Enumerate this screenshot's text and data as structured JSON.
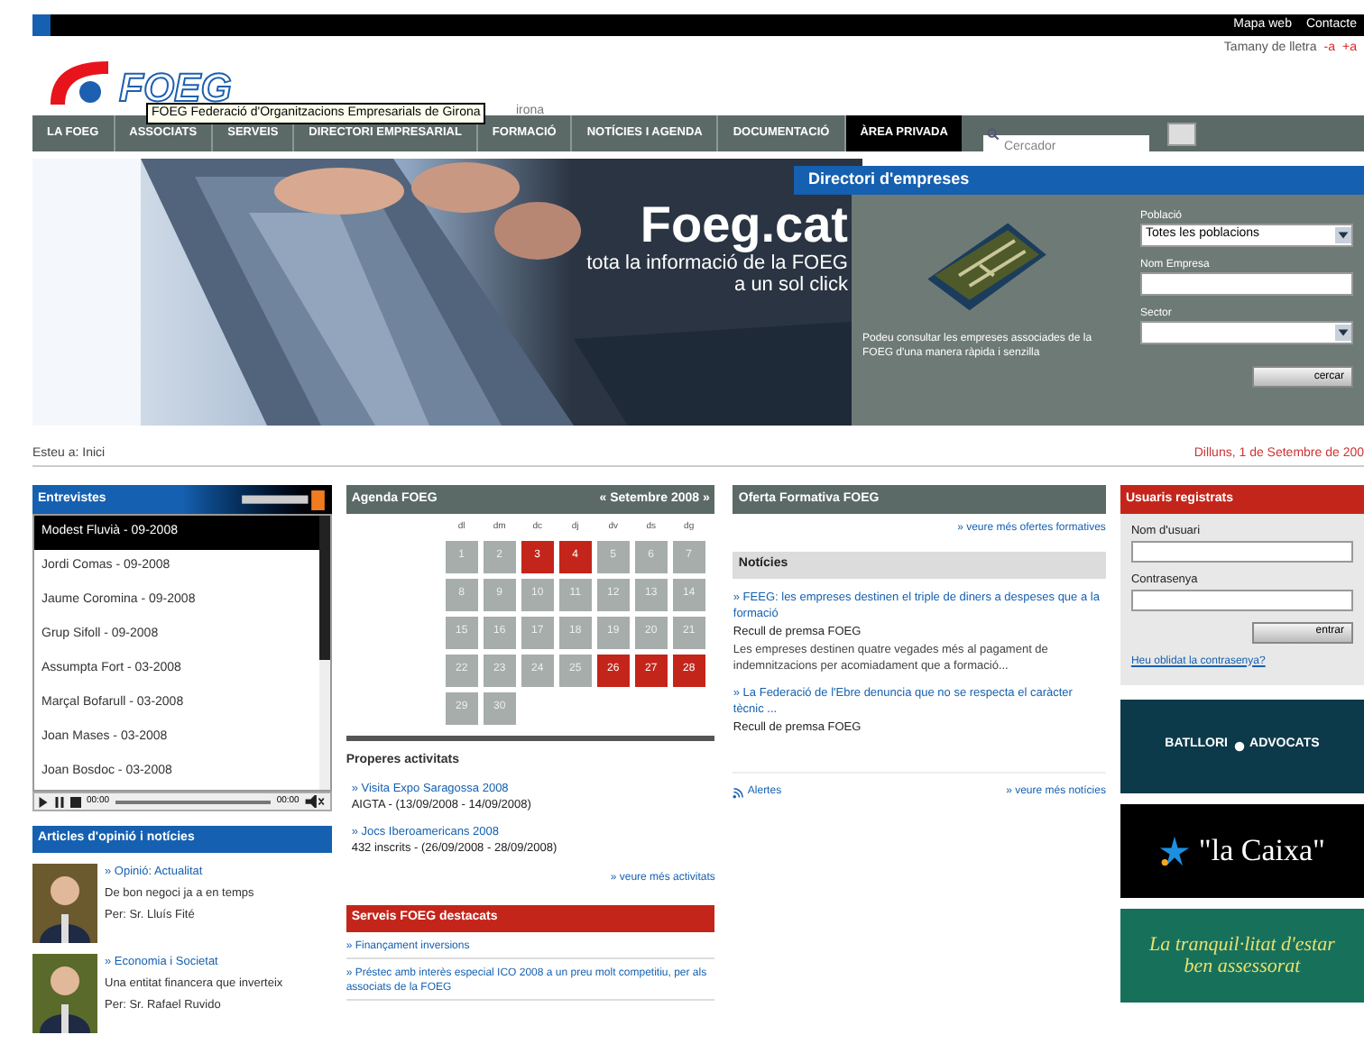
{
  "top_bar": {
    "links": [
      "Mapa web",
      "Contacte"
    ]
  },
  "font_size": {
    "label": "Tamany de lletra",
    "decrease": "-a",
    "increase": "+a"
  },
  "logo": {
    "text": "FOEG",
    "tagline": "irona"
  },
  "tooltip": "FOEG Federació d'Organitzacions Empresarials de Girona",
  "nav": [
    {
      "label": "LA FOEG",
      "selected": false
    },
    {
      "label": "ASSOCIATS",
      "selected": false
    },
    {
      "label": "SERVEIS",
      "selected": false
    },
    {
      "label": "DIRECTORI EMPRESARIAL",
      "selected": false
    },
    {
      "label": "FORMACIÓ",
      "selected": false
    },
    {
      "label": "NOTÍCIES I AGENDA",
      "selected": false
    },
    {
      "label": "DOCUMENTACIÓ",
      "selected": false
    },
    {
      "label": "ÀREA PRIVADA",
      "selected": true
    }
  ],
  "search": {
    "placeholder": "Cercador"
  },
  "hero": {
    "kind": "picture",
    "title": "Foeg.cat",
    "subtitle": [
      "tota la informació de la FOEG",
      "a un sol click"
    ]
  },
  "directory": {
    "title": "Directori d'empreses",
    "description": "Podeu consultar les empreses associades de la FOEG d'una manera ràpida i senzilla",
    "fields": [
      {
        "kind": "select",
        "label": "Població",
        "value": "Totes les poblacions"
      },
      {
        "kind": "input",
        "label": "Nom Empresa"
      },
      {
        "kind": "select",
        "label": "Sector"
      }
    ],
    "button": "cercar"
  },
  "breadcrumb": "Esteu a: Inici",
  "date": "Dilluns, 1 de Setembre de 200",
  "interviews": {
    "title": "Entrevistes",
    "items": [
      {
        "label": "Modest Fluvià - 09-2008",
        "selected": true
      },
      {
        "label": "Jordi Comas - 09-2008",
        "selected": false
      },
      {
        "label": "Jaume Coromina - 09-2008",
        "selected": false
      },
      {
        "label": "Grup Sifoll - 09-2008",
        "selected": false
      },
      {
        "label": "Assumpta Fort - 03-2008",
        "selected": false
      },
      {
        "label": "Marçal Bofarull - 03-2008",
        "selected": false
      },
      {
        "label": "Joan Mases - 03-2008",
        "selected": false
      },
      {
        "label": "Joan Bosdoc - 03-2008",
        "selected": false
      }
    ],
    "player": {
      "times": [
        "00:00",
        "00:00"
      ]
    }
  },
  "articles": {
    "title": "Articles d'opinió i notícies",
    "items": [
      {
        "section": "» Opinió: Actualitat",
        "headline": "De bon negoci ja a en temps",
        "author": "Per: Sr. Lluís Fité"
      },
      {
        "section": "» Economia i Societat",
        "headline": "Una entitat financera que inverteix",
        "author": "Per: Sr. Rafael Ruvido"
      }
    ]
  },
  "agenda": {
    "title": "Agenda FOEG",
    "month": "« Setembre 2008 »",
    "weekdays": [
      "dl",
      "dm",
      "dc",
      "dj",
      "dv",
      "ds",
      "dg"
    ],
    "days": [
      {
        "label": "1",
        "event": false
      },
      {
        "label": "2",
        "event": false
      },
      {
        "label": "3",
        "event": true
      },
      {
        "label": "4",
        "event": true
      },
      {
        "label": "5",
        "event": false
      },
      {
        "label": "6",
        "event": false
      },
      {
        "label": "7",
        "event": false
      },
      {
        "label": "8",
        "event": false
      },
      {
        "label": "9",
        "event": false
      },
      {
        "label": "10",
        "event": false
      },
      {
        "label": "11",
        "event": false
      },
      {
        "label": "12",
        "event": false
      },
      {
        "label": "13",
        "event": false
      },
      {
        "label": "14",
        "event": false
      },
      {
        "label": "15",
        "event": false
      },
      {
        "label": "16",
        "event": false
      },
      {
        "label": "17",
        "event": false
      },
      {
        "label": "18",
        "event": false
      },
      {
        "label": "19",
        "event": false
      },
      {
        "label": "20",
        "event": false
      },
      {
        "label": "21",
        "event": false
      },
      {
        "label": "22",
        "event": false
      },
      {
        "label": "23",
        "event": false
      },
      {
        "label": "24",
        "event": false
      },
      {
        "label": "25",
        "event": false
      },
      {
        "label": "26",
        "event": true
      },
      {
        "label": "27",
        "event": true
      },
      {
        "label": "28",
        "event": true
      },
      {
        "label": "29",
        "event": false
      },
      {
        "label": "30",
        "event": false
      }
    ]
  },
  "upcoming": {
    "title": "Properes activitats",
    "items": [
      {
        "link": "» Visita Expo Saragossa 2008",
        "detail": "AIGTA - (13/09/2008 - 14/09/2008)"
      },
      {
        "link": "» Jocs Iberoamericans 2008",
        "detail": "432 inscrits - (26/09/2008 - 28/09/2008)"
      }
    ],
    "more": "» veure més activitats"
  },
  "services": {
    "title": "Serveis FOEG destacats",
    "items": [
      "» Finançament inversions",
      "» Préstec amb interès especial ICO 2008 a un preu molt competitiu, per als associats de la FOEG"
    ]
  },
  "training": {
    "title": "Oferta Formativa FOEG",
    "more": "» veure més ofertes formatives"
  },
  "news": {
    "title": "Notícies",
    "items": [
      {
        "link": "» FEEG: les empreses destinen el triple de diners a despeses que a la formació",
        "source": "Recull de premsa FOEG",
        "summary": "Les empreses destinen quatre vegades més al pagament de indemnitzacions per acomiadament que a formació..."
      },
      {
        "link": "» La Federació de l'Ebre denuncia que no se respecta el caràcter tècnic ...",
        "source": "Recull de premsa FOEG"
      }
    ],
    "rss": "Alertes",
    "more": "» veure més notícies"
  },
  "login": {
    "title": "Usuaris registrats",
    "fields": [
      "Nom d'usuari",
      "Contrasenya"
    ],
    "button": "entrar",
    "forgot": "Heu oblidat la contrasenya?"
  },
  "ads": [
    {
      "kind": "batllori",
      "text": [
        "BATLLORI",
        "ADVOCATS"
      ]
    },
    {
      "kind": "caixa",
      "text": "\"la Caixa\""
    },
    {
      "kind": "slogan",
      "text": "La tranquil·litat d'estar ben assessorat"
    }
  ]
}
